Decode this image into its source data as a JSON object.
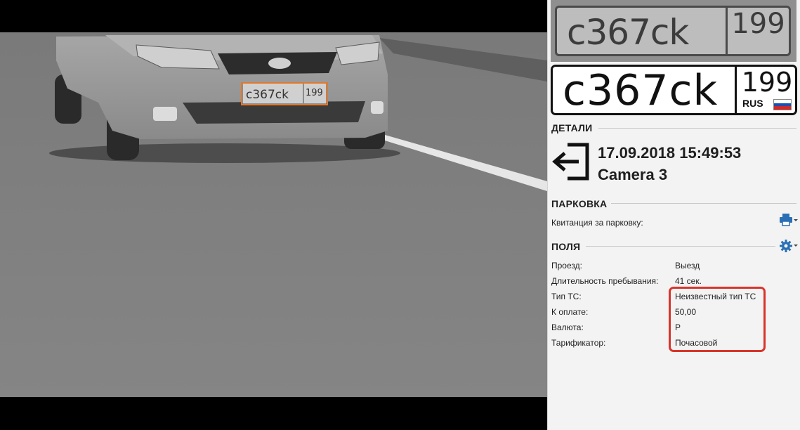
{
  "plate_crop": {
    "number": "c367ck",
    "region": "199"
  },
  "plate": {
    "number": "c367ck",
    "region": "199",
    "country": "RUS"
  },
  "details": {
    "title": "ДЕТАЛИ",
    "datetime": "17.09.2018 15:49:53",
    "camera": "Camera 3",
    "direction_icon": "exit-icon"
  },
  "parking": {
    "title": "ПАРКОВКА",
    "receipt_label": "Квитанция за парковку:",
    "print_icon": "printer-icon"
  },
  "fields": {
    "title": "ПОЛЯ",
    "settings_icon": "gear-icon",
    "rows": [
      {
        "label": "Проезд:",
        "value": "Выезд"
      },
      {
        "label": "Длительность пребывания:",
        "value": "41 сек."
      },
      {
        "label": "Тип ТС:",
        "value": "Неизвестный тип ТС"
      },
      {
        "label": "К оплате:",
        "value": "50,00"
      },
      {
        "label": "Валюта:",
        "value": "Р"
      },
      {
        "label": "Тарификатор:",
        "value": "Почасовой"
      }
    ]
  },
  "colors": {
    "highlight": "#d9342b",
    "plate_box": "#e07a2e",
    "accent_icon": "#2a6fb5",
    "flag": [
      "#ffffff",
      "#1c4fb0",
      "#d0282b"
    ]
  }
}
